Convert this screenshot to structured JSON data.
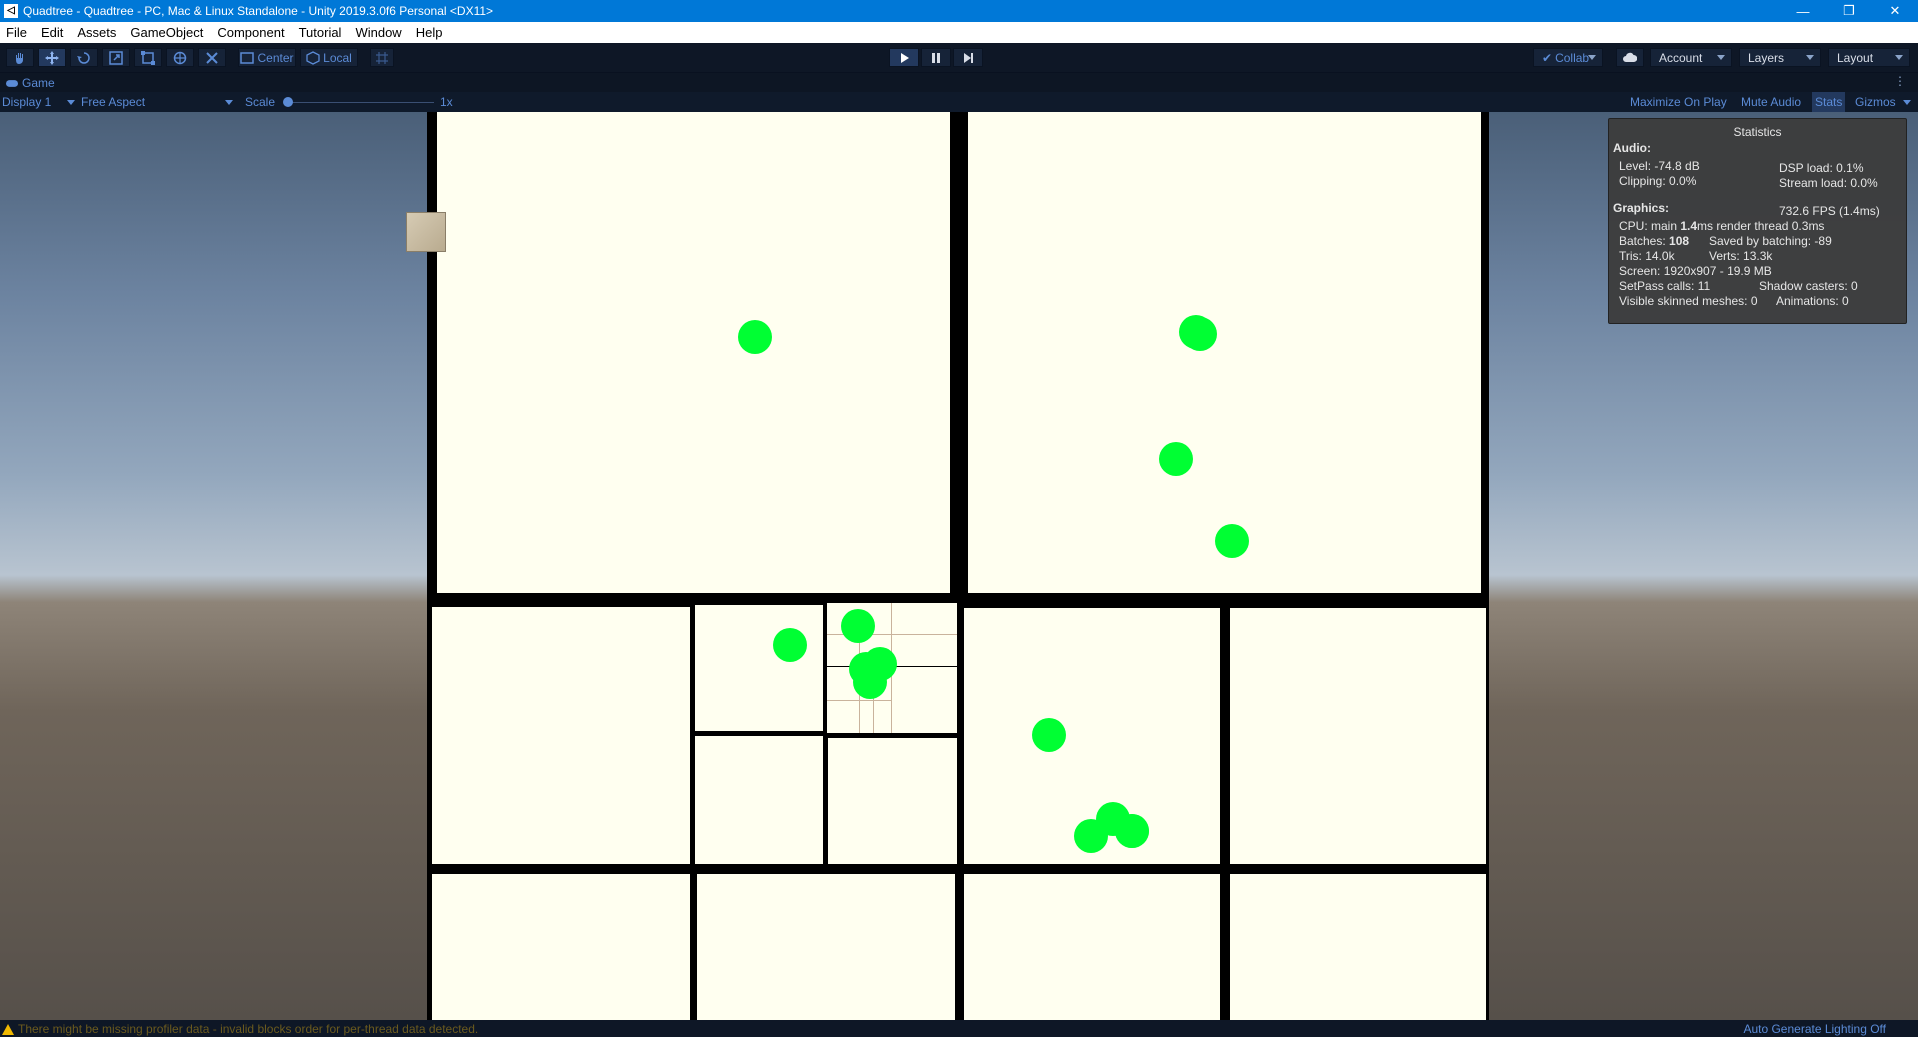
{
  "titlebar": {
    "title": "Quadtree - Quadtree - PC, Mac & Linux Standalone - Unity 2019.3.0f6 Personal <DX11>",
    "minimize": "—",
    "restore": "❐",
    "close": "✕"
  },
  "menu": [
    "File",
    "Edit",
    "Assets",
    "GameObject",
    "Component",
    "Tutorial",
    "Window",
    "Help"
  ],
  "toolbar": {
    "pivot_label": "Center",
    "space_label": "Local",
    "collab_label": "Collab",
    "account_label": "Account",
    "layers_label": "Layers",
    "layout_label": "Layout"
  },
  "game_tab": {
    "label": "Game"
  },
  "game_toolbar": {
    "display": "Display 1",
    "aspect": "Free Aspect",
    "scale_label": "Scale",
    "scale_value": "1x",
    "maximize": "Maximize On Play",
    "mute": "Mute Audio",
    "stats": "Stats",
    "gizmos": "Gizmos"
  },
  "stats": {
    "title": "Statistics",
    "audio_header": "Audio:",
    "level": "Level: -74.8 dB",
    "dsp": "DSP load: 0.1%",
    "clipping": "Clipping: 0.0%",
    "stream": "Stream load: 0.0%",
    "graphics_header": "Graphics:",
    "fps": "732.6 FPS (1.4ms)",
    "cpu_prefix": "CPU: main ",
    "cpu_main": "1.4",
    "cpu_suffix": "ms  render thread 0.3ms",
    "batches_prefix": "Batches: ",
    "batches": "108",
    "saved": "Saved by batching: -89",
    "tris": "Tris: 14.0k",
    "verts": "Verts: 13.3k",
    "screen": "Screen: 1920x907 - 19.9 MB",
    "setpass": "SetPass calls: 11",
    "shadow": "Shadow casters: 0",
    "skinned": "Visible skinned meshes: 0",
    "animations": "Animations: 0"
  },
  "status": {
    "warning": "There might be missing profiler data - invalid blocks order for per-thread data detected.",
    "lighting": "Auto Generate Lighting Off"
  },
  "colors": {
    "titlebar": "#0078d7",
    "cell": "#fffff0",
    "ball": "#00ff33",
    "toolbar_accent": "#5b8bd6"
  }
}
